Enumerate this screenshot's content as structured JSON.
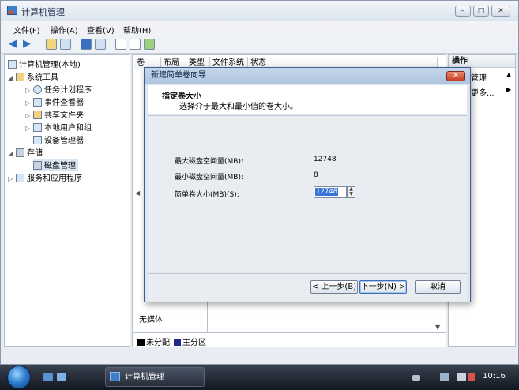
{
  "window": {
    "title": "计算机管理"
  },
  "menu": [
    "文件(F)",
    "操作(A)",
    "查看(V)",
    "帮助(H)"
  ],
  "tree": {
    "root": "计算机管理(本地)",
    "items": [
      "系统工具",
      "任务计划程序",
      "事件查看器",
      "共享文件夹",
      "本地用户和组",
      "设备管理器",
      "存储",
      "磁盘管理",
      "服务和应用程序"
    ]
  },
  "columns": [
    "卷",
    "布局",
    "类型",
    "文件系统",
    "状态"
  ],
  "actions": {
    "header": "操作",
    "items": [
      "管理",
      "更多..."
    ]
  },
  "lower_pane": {
    "no_media": "无媒体",
    "legend": [
      "未分配",
      "主分区"
    ]
  },
  "dialog": {
    "title": "新建简单卷向导",
    "heading": "指定卷大小",
    "subtitle": "选择介于最大和最小值的卷大小。",
    "fields": [
      {
        "label": "最大磁盘空间量(MB):",
        "value": "12748"
      },
      {
        "label": "最小磁盘空间量(MB):",
        "value": "8"
      },
      {
        "label": "简单卷大小(MB)(S):",
        "value": "12748"
      }
    ],
    "buttons": {
      "back": "< 上一步(B)",
      "next": "下一步(N) >",
      "cancel": "取消"
    }
  },
  "taskbar": {
    "app": "计算机管理",
    "time": "10:16"
  },
  "colors": {
    "unallocated": "#000000",
    "primary": "#1f2a8c",
    "dialog_border": "#3b5d91"
  }
}
